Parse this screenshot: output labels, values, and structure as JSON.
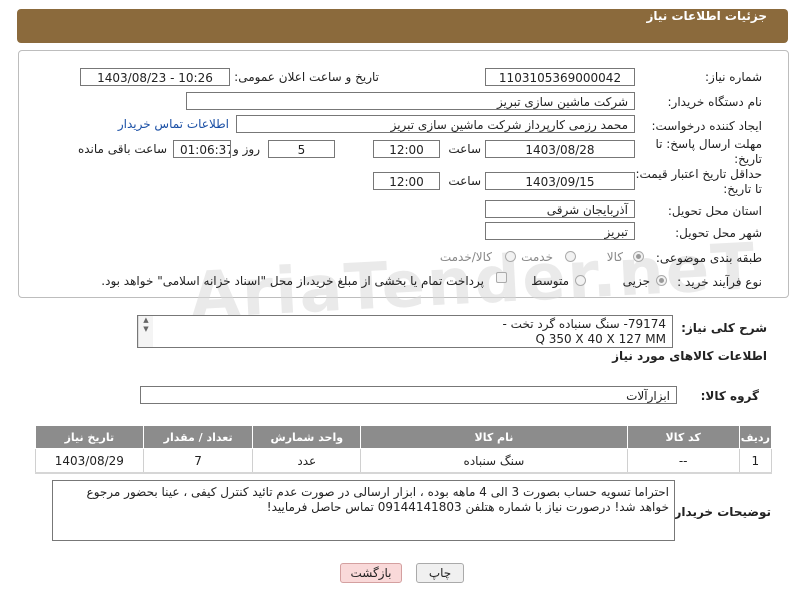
{
  "header": {
    "title": "جزئیات اطلاعات نیاز"
  },
  "form": {
    "need_number_label": "شماره نیاز:",
    "need_number": "1103105369000042",
    "announce_label": "تاریخ و ساعت اعلان عمومی:",
    "announce_value": "1403/08/23 - 10:26",
    "buyer_org_label": "نام دستگاه خریدار:",
    "buyer_org": "شرکت ماشین سازی تبریز",
    "creator_label": "ایجاد کننده درخواست:",
    "creator": "محمد رزمی کارپرداز شرکت ماشین سازی تبریز",
    "contact_link": "اطلاعات تماس خریدار",
    "reply_deadline_label": "مهلت ارسال پاسخ: تا تاریخ:",
    "reply_date": "1403/08/28",
    "time_label": "ساعت",
    "reply_time": "12:00",
    "days_value": "5",
    "days_label": "روز و",
    "remaining_time": "01:06:37",
    "remaining_label": "ساعت باقی مانده",
    "price_validity_label": "حداقل تاریخ اعتبار قیمت: تا تاریخ:",
    "price_date": "1403/09/15",
    "price_time": "12:00",
    "province_label": "استان محل تحویل:",
    "province": "آذربایجان شرقی",
    "city_label": "شهر محل تحویل:",
    "city": "تبریز",
    "category_label": "طبقه بندی موضوعی:",
    "category_options": [
      "کالا",
      "خدمت",
      "کالا/خدمت"
    ],
    "process_label": "نوع فرآیند خرید :",
    "process_options": [
      "جزیی",
      "متوسط"
    ],
    "payment_note": "پرداخت تمام یا بخشی از مبلغ خرید،از محل \"اسناد خزانه اسلامی\" خواهد بود."
  },
  "description": {
    "label": "شرح کلی نیاز:",
    "line1": "79174- سنگ سنباده گرد تخت -",
    "line2": "Q 350 X 40 X 127  MM"
  },
  "goods": {
    "section_title": "اطلاعات کالاهای مورد نیاز",
    "group_label": "گروه کالا:",
    "group_value": "ابزارآلات",
    "columns": [
      "ردیف",
      "کد کالا",
      "نام کالا",
      "واحد شمارش",
      "تعداد / مقدار",
      "تاریخ نیاز"
    ],
    "rows": [
      {
        "row": "1",
        "code": "--",
        "name": "سنگ سنباده",
        "unit": "عدد",
        "qty": "7",
        "date": "1403/08/29"
      }
    ]
  },
  "buyer_notes": {
    "label": "توضیحات خریدار:",
    "text": "احتراما تسویه حساب بصورت 3 الی 4 ماهه بوده ، ابزار ارسالی در صورت عدم تائید کنترل کیفی ، عینا بحضور مرجوع خواهد شد! درصورت نیاز با شماره هتلفن 09144141803 تماس حاصل فرمایید!"
  },
  "actions": {
    "print": "چاپ",
    "back": "بازگشت"
  },
  "watermark": "AriaTender.neT",
  "colors": {
    "header": "#8b6a3c",
    "table_header": "#8c8c8c",
    "link": "#1a4fa5",
    "back_button": "#f9d9d9"
  }
}
